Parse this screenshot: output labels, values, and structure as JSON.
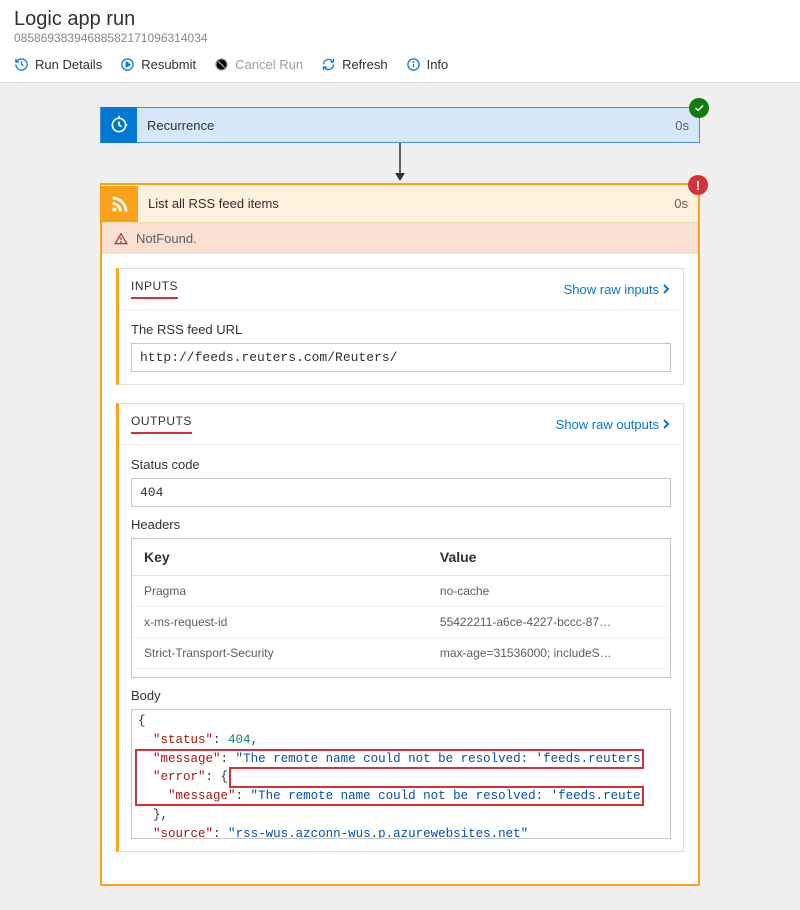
{
  "header": {
    "title": "Logic app run",
    "run_id": "08586938394688582171096314034"
  },
  "toolbar": {
    "run_details": "Run Details",
    "resubmit": "Resubmit",
    "cancel_run": "Cancel Run",
    "refresh": "Refresh",
    "info": "Info"
  },
  "recurrence": {
    "title": "Recurrence",
    "duration": "0s",
    "status": "success"
  },
  "rss": {
    "title": "List all RSS feed items",
    "duration": "0s",
    "status": "error",
    "error_label": "NotFound.",
    "inputs": {
      "title": "INPUTS",
      "raw_link": "Show raw inputs",
      "url_label": "The RSS feed URL",
      "url_value": "http://feeds.reuters.com/Reuters/"
    },
    "outputs": {
      "title": "OUTPUTS",
      "raw_link": "Show raw outputs",
      "status_label": "Status code",
      "status_value": "404",
      "headers_label": "Headers",
      "headers_key": "Key",
      "headers_value": "Value",
      "headers": [
        {
          "k": "Pragma",
          "v": "no-cache"
        },
        {
          "k": "x-ms-request-id",
          "v": "55422211-a6ce-4227-bccc-87…"
        },
        {
          "k": "Strict-Transport-Security",
          "v": "max-age=31536000; includeS…"
        }
      ],
      "body_label": "Body",
      "body": {
        "status": 404,
        "message": "The remote name could not be resolved: 'feeds.reuters",
        "error_message": "The remote name could not be resolved: 'feeds.reute",
        "source": "rss-wus.azconn-wus.p.azurewebsites.net"
      }
    }
  }
}
